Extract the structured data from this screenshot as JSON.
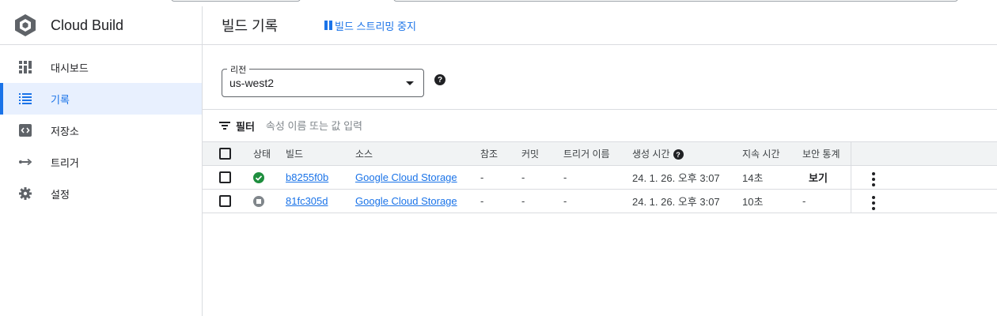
{
  "app": {
    "name": "Cloud Build"
  },
  "sidebar": {
    "items": [
      {
        "label": "대시보드",
        "icon": "dashboard-icon",
        "active": false
      },
      {
        "label": "기록",
        "icon": "history-list-icon",
        "active": true
      },
      {
        "label": "저장소",
        "icon": "repository-icon",
        "active": false
      },
      {
        "label": "트리거",
        "icon": "trigger-icon",
        "active": false
      },
      {
        "label": "설정",
        "icon": "settings-gear-icon",
        "active": false
      }
    ]
  },
  "header": {
    "title": "빌드 기록",
    "stream_label": "빌드 스트리밍 중지"
  },
  "region": {
    "label": "리전",
    "value": "us-west2"
  },
  "filter": {
    "label": "필터",
    "placeholder": "속성 이름 또는 값 입력"
  },
  "table": {
    "columns": {
      "status": "상태",
      "build": "빌드",
      "source": "소스",
      "ref": "참조",
      "commit": "커밋",
      "trigger": "트리거 이름",
      "created": "생성 시간",
      "duration": "지속 시간",
      "security": "보안 통계"
    },
    "rows": [
      {
        "status": "success",
        "build": "b8255f0b",
        "source": "Google Cloud Storage",
        "ref": "-",
        "commit": "-",
        "trigger": "-",
        "created": "24. 1. 26. 오후 3:07",
        "duration": "14초",
        "security": "보기"
      },
      {
        "status": "cancelled",
        "build": "81fc305d",
        "source": "Google Cloud Storage",
        "ref": "-",
        "commit": "-",
        "trigger": "-",
        "created": "24. 1. 26. 오후 3:07",
        "duration": "10초",
        "security": "-"
      }
    ]
  },
  "colors": {
    "accent": "#1a73e8",
    "success": "#1e8e3e",
    "neutral": "#80868b"
  }
}
